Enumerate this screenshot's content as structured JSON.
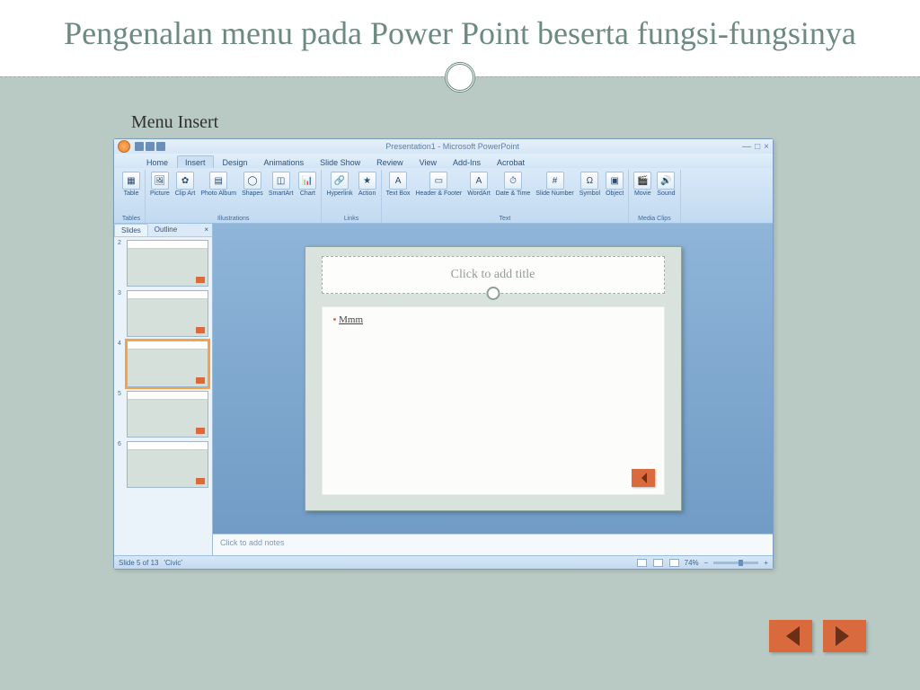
{
  "slide": {
    "title": "Pengenalan menu pada Power Point beserta fungsi-fungsinya",
    "section_label": "Menu Insert"
  },
  "pp": {
    "title": "Presentation1 - Microsoft PowerPoint",
    "tabs": [
      "Home",
      "Insert",
      "Design",
      "Animations",
      "Slide Show",
      "Review",
      "View",
      "Add-Ins",
      "Acrobat"
    ],
    "active_tab": "Insert",
    "ribbon_groups": [
      {
        "label": "Tables",
        "items": [
          {
            "label": "Table",
            "icon": "▦"
          }
        ]
      },
      {
        "label": "Illustrations",
        "items": [
          {
            "label": "Picture",
            "icon": "🖼"
          },
          {
            "label": "Clip Art",
            "icon": "✿"
          },
          {
            "label": "Photo Album",
            "icon": "▤"
          },
          {
            "label": "Shapes",
            "icon": "◯"
          },
          {
            "label": "SmartArt",
            "icon": "◫"
          },
          {
            "label": "Chart",
            "icon": "📊"
          }
        ]
      },
      {
        "label": "Links",
        "items": [
          {
            "label": "Hyperlink",
            "icon": "🔗"
          },
          {
            "label": "Action",
            "icon": "★"
          }
        ]
      },
      {
        "label": "Text",
        "items": [
          {
            "label": "Text Box",
            "icon": "A"
          },
          {
            "label": "Header & Footer",
            "icon": "▭"
          },
          {
            "label": "WordArt",
            "icon": "A"
          },
          {
            "label": "Date & Time",
            "icon": "⏱"
          },
          {
            "label": "Slide Number",
            "icon": "#"
          },
          {
            "label": "Symbol",
            "icon": "Ω"
          },
          {
            "label": "Object",
            "icon": "▣"
          }
        ]
      },
      {
        "label": "Media Clips",
        "items": [
          {
            "label": "Movie",
            "icon": "🎬"
          },
          {
            "label": "Sound",
            "icon": "🔊"
          }
        ]
      }
    ],
    "panel_tabs": {
      "slides": "Slides",
      "outline": "Outline"
    },
    "thumbs": [
      2,
      3,
      4,
      5,
      6
    ],
    "selected_thumb": 4,
    "canvas": {
      "title_placeholder": "Click to add title",
      "bullet_text": "Mmm"
    },
    "notes_placeholder": "Click to add notes",
    "status": {
      "slide": "Slide 5 of 13",
      "theme": "'Civic'",
      "zoom": "74%"
    }
  }
}
